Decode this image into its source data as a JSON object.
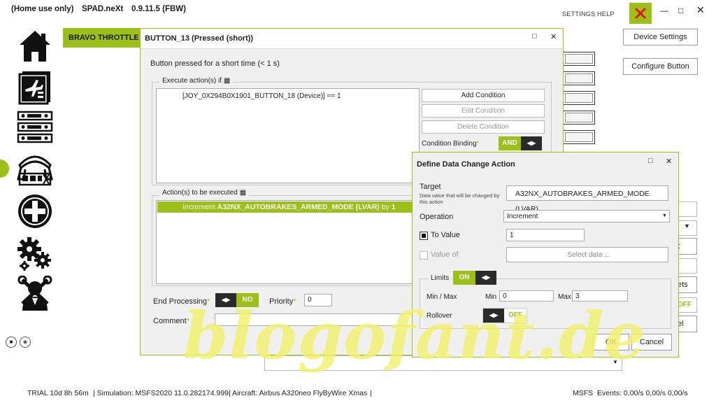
{
  "app": {
    "edition": "(Home use only)",
    "name": "SPAD.neXt",
    "version": "0.9.11.5 (FBW)",
    "links": [
      "SETTINGS",
      "HELP"
    ],
    "window_controls": [
      "minimize",
      "maximize",
      "close"
    ]
  },
  "rail": {
    "icons": [
      "home-icon",
      "flight-checklist-icon",
      "device-panels-icon",
      "cockpit-icon",
      "add-icon",
      "gears-icon",
      "support-icon"
    ],
    "bottom_icons": [
      "save-icon",
      "package-icon"
    ]
  },
  "background": {
    "device_tab": "BRAVO THROTTLE Q",
    "device_settings": "Device Settings",
    "configure_button": "Configure Button",
    "partial_labels": [
      "t",
      "ets",
      "OFF",
      "el"
    ]
  },
  "button_dialog": {
    "title": "BUTTON_13 (Pressed (short))",
    "description": "Button pressed for a short time (< 1 s)",
    "execute_if_label": "Execute action(s) if",
    "condition_text": "[JOY_0X294B0X1901_BUTTON_18 (Device)] == 1",
    "add_condition": "Add Condition",
    "edit_condition": "Edit Condition",
    "delete_condition": "Delete Condition",
    "condition_binding_label": "Condition Binding",
    "condition_binding_value": "AND",
    "actions_label": "Action(s) to be executed",
    "action_prefix": "Increment",
    "action_target": "A32NX_AUTOBRAKES_ARMED_MODE (LVAR)",
    "action_by": "by",
    "action_value": "1",
    "end_processing_label": "End Processing",
    "end_processing_value": "NO",
    "priority_label": "Priority",
    "priority_value": "0",
    "comment_label": "Comment",
    "comment_value": ""
  },
  "data_dialog": {
    "title": "Define Data Change Action",
    "target_label": "Target",
    "target_hint": "Data value that will be changed by this action",
    "target_value": "A32NX_AUTOBRAKES_ARMED_MODE (LVAR)",
    "operation_label": "Operation",
    "operation_value": "Increment",
    "to_value_label": "To Value",
    "to_value": "1",
    "value_of_label": "Value of",
    "select_data": "Select data ...",
    "limits_label": "Limits",
    "limits_value": "ON",
    "minmax_label": "Min / Max",
    "min_label": "Min",
    "min_value": "0",
    "max_label": "Max",
    "max_value": "3",
    "rollover_label": "Rollover",
    "rollover_value": "OFF",
    "ok": "OK",
    "cancel": "Cancel"
  },
  "status": {
    "trial": "TRIAL 10d 8h 56m",
    "simulation": "| Simulation: MSFS2020 11.0.282174.999",
    "aircraft": "| Aircraft: Airbus A320neo FlyByWire Xmas",
    "sep": "|",
    "sim": "MSFS",
    "events": "Events: 0,00/s 0,00/s 0,00/s"
  },
  "watermark": "blogofant.de",
  "colors": {
    "accent": "#9cbf1a",
    "dark": "#2a2a2a",
    "close_x": "#e01818",
    "watermark": "#f1f26a"
  }
}
